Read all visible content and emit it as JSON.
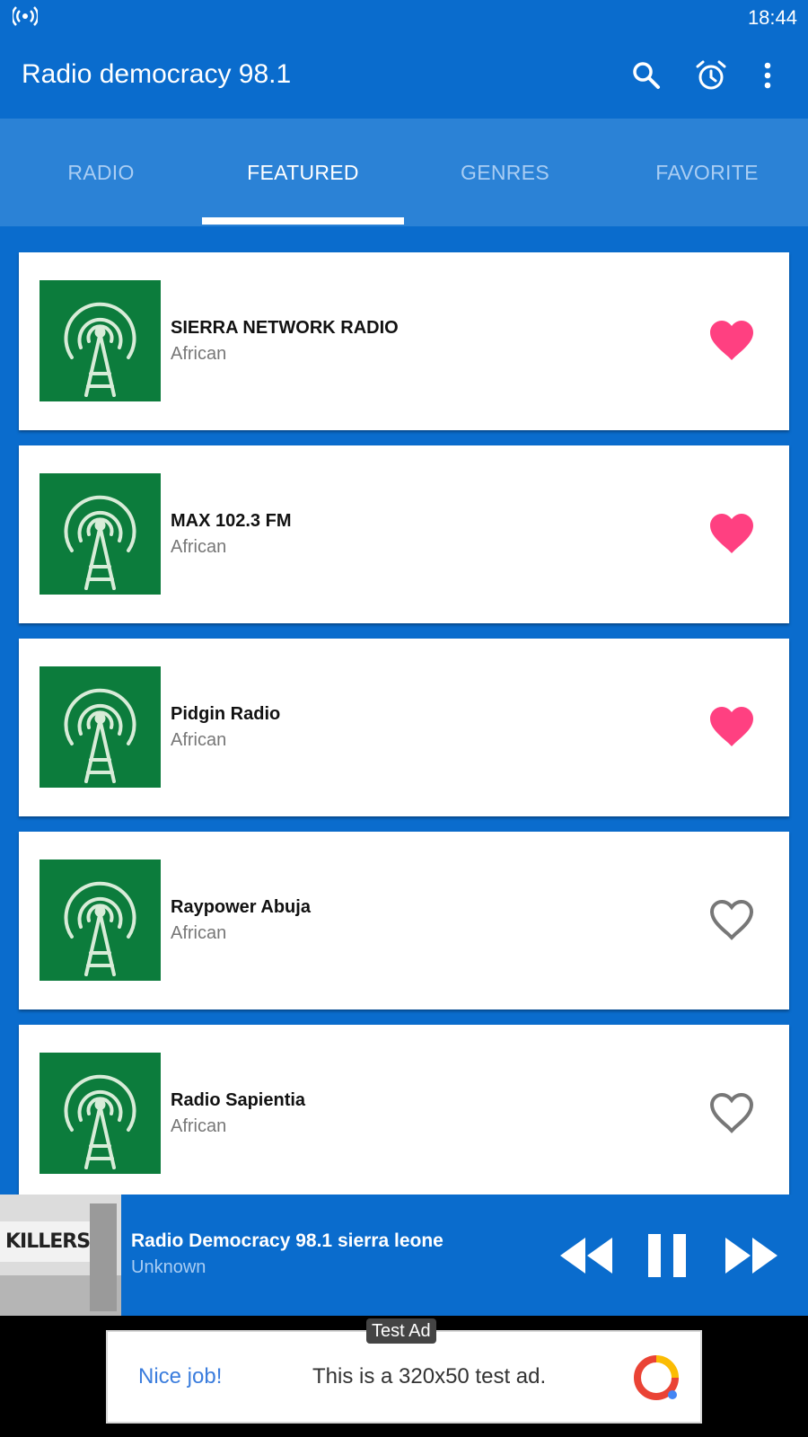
{
  "status_bar": {
    "time": "18:44"
  },
  "app_bar": {
    "title": "Radio democracy 98.1",
    "icons": [
      "search-icon",
      "alarm-icon",
      "more-vert-icon"
    ]
  },
  "tabs": [
    {
      "label": "RADIO",
      "active": false
    },
    {
      "label": "FEATURED",
      "active": true
    },
    {
      "label": "GENRES",
      "active": false
    },
    {
      "label": "FAVORITE",
      "active": false
    }
  ],
  "stations": [
    {
      "name": "SIERRA NETWORK RADIO",
      "genre": "African",
      "favorite": true
    },
    {
      "name": "MAX 102.3 FM",
      "genre": "African",
      "favorite": true
    },
    {
      "name": "Pidgin Radio",
      "genre": "African",
      "favorite": true
    },
    {
      "name": "Raypower Abuja",
      "genre": "African",
      "favorite": false
    },
    {
      "name": "Radio Sapientia",
      "genre": "African",
      "favorite": false
    }
  ],
  "player": {
    "title": "Radio Democracy 98.1 sierra leone",
    "artist": "Unknown",
    "album_text": "KILLERS"
  },
  "ad": {
    "label": "Test Ad",
    "nice": "Nice job!",
    "text": "This is a 320x50 test ad."
  },
  "colors": {
    "primary": "#0a6ccd",
    "tab_bar": "#2b82d6",
    "logo_green": "#0c7c3c",
    "favorite_pink": "#ff4081"
  }
}
